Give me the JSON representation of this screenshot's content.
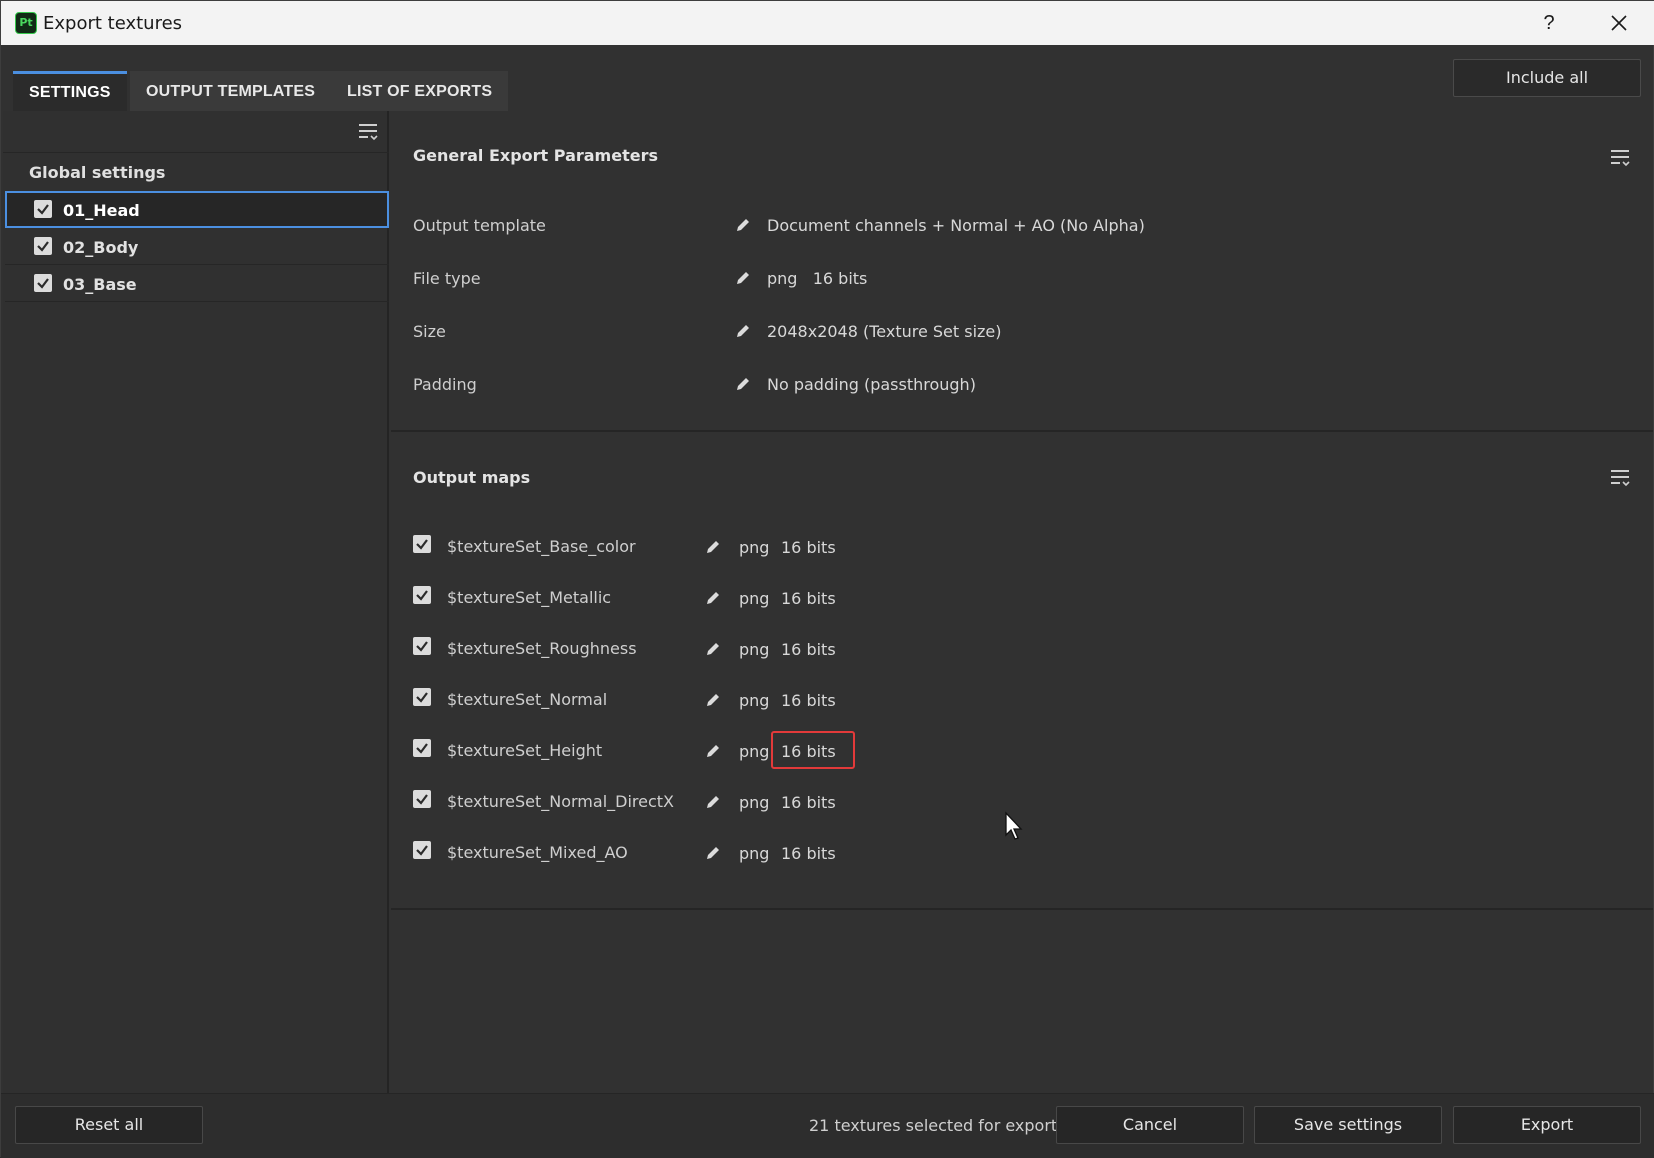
{
  "window": {
    "title": "Export textures",
    "app_icon_text": "Pt",
    "help_label": "?"
  },
  "tabs": [
    {
      "label": "SETTINGS",
      "active": true
    },
    {
      "label": "OUTPUT TEMPLATES",
      "active": false
    },
    {
      "label": "LIST OF EXPORTS",
      "active": false
    }
  ],
  "include_all_label": "Include all",
  "left_panel": {
    "global_label": "Global settings",
    "texture_sets": [
      {
        "name": "01_Head",
        "checked": true,
        "selected": true
      },
      {
        "name": "02_Body",
        "checked": true,
        "selected": false
      },
      {
        "name": "03_Base",
        "checked": true,
        "selected": false
      }
    ]
  },
  "general": {
    "title": "General Export Parameters",
    "params": [
      {
        "label": "Output template",
        "value": "Document channels + Normal + AO (No Alpha)"
      },
      {
        "label": "File type",
        "value": "png   16 bits"
      },
      {
        "label": "Size",
        "value": "2048x2048 (Texture Set size)"
      },
      {
        "label": "Padding",
        "value": "No padding (passthrough)"
      }
    ]
  },
  "output_maps": {
    "title": "Output maps",
    "maps": [
      {
        "name": "$textureSet_Base_color",
        "format": "png",
        "bits": "16 bits",
        "checked": true
      },
      {
        "name": "$textureSet_Metallic",
        "format": "png",
        "bits": "16 bits",
        "checked": true
      },
      {
        "name": "$textureSet_Roughness",
        "format": "png",
        "bits": "16 bits",
        "checked": true
      },
      {
        "name": "$textureSet_Normal",
        "format": "png",
        "bits": "16 bits",
        "checked": true
      },
      {
        "name": "$textureSet_Height",
        "format": "png",
        "bits": "16 bits",
        "checked": true,
        "highlighted": true
      },
      {
        "name": "$textureSet_Normal_DirectX",
        "format": "png",
        "bits": "16 bits",
        "checked": true
      },
      {
        "name": "$textureSet_Mixed_AO",
        "format": "png",
        "bits": "16 bits",
        "checked": true
      }
    ]
  },
  "footer": {
    "reset_label": "Reset all",
    "status": "21 textures selected for export",
    "cancel_label": "Cancel",
    "save_label": "Save settings",
    "export_label": "Export"
  },
  "colors": {
    "accent": "#4b8fe0",
    "highlight": "#e23a3a",
    "app_green": "#36c94c"
  }
}
